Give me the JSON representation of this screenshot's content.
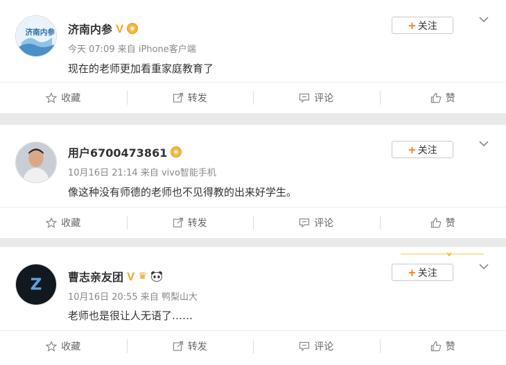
{
  "posts": [
    {
      "username": "济南内参",
      "meta": "今天 07:09 来自 iPhone客户端",
      "content": "现在的老师更加看重家庭教育了",
      "follow_label": "关注",
      "avatar_text": "济南内参"
    },
    {
      "username": "用户6700473861",
      "meta": "10月16日 21:14 来自 vivo智能手机",
      "content": "像这种没有师德的老师也不见得教的出来好学生。",
      "follow_label": "关注"
    },
    {
      "username": "曹志亲友团",
      "meta": "10月16日 20:55 来自 鸭梨山大",
      "content": "老师也是很让人无语了……",
      "follow_label": "关注",
      "avatar_text": "Z"
    }
  ],
  "actions": {
    "favorite": "收藏",
    "repost": "转发",
    "comment": "评论",
    "like": "赞"
  },
  "badges": {
    "verified_v": "V"
  },
  "colors": {
    "accent_orange": "#f77b1e",
    "verified_gold": "#f5a623",
    "text_primary": "#333333",
    "text_meta": "#888888",
    "page_bg": "#e9e9e9"
  }
}
